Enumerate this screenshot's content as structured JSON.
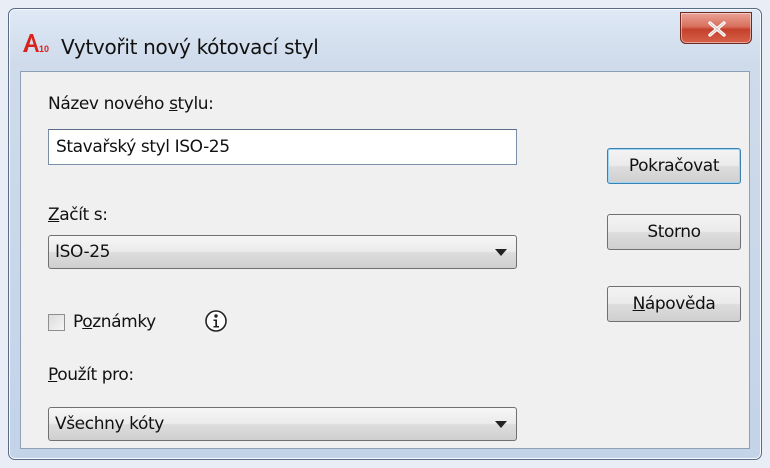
{
  "window": {
    "title": "Vytvořit nový kótovací styl",
    "icon": "autocad-app-icon",
    "close_label": "close-icon"
  },
  "form": {
    "new_style_name_label": {
      "before": "Název nového ",
      "accel": "s",
      "after": "tylu:"
    },
    "new_style_name_value": "Stavařský styl ISO-25",
    "start_with_label": {
      "accel": "Z",
      "after": "ačít s:"
    },
    "start_with_value": "ISO-25",
    "annotative_label": {
      "before": "P",
      "accel": "o",
      "after": "známky"
    },
    "annotative_checked": false,
    "use_for_label": {
      "accel": "P",
      "after": "oužít pro:"
    },
    "use_for_value": "Všechny kóty"
  },
  "buttons": {
    "continue_label": "Pokračovat",
    "cancel_label": "Storno",
    "help_label": {
      "accel": "N",
      "after": "ápověda"
    }
  },
  "colors": {
    "close_button": "#c4412b",
    "dialog_background": "#f0f0f0",
    "default_button_border": "#3c7fb1"
  }
}
